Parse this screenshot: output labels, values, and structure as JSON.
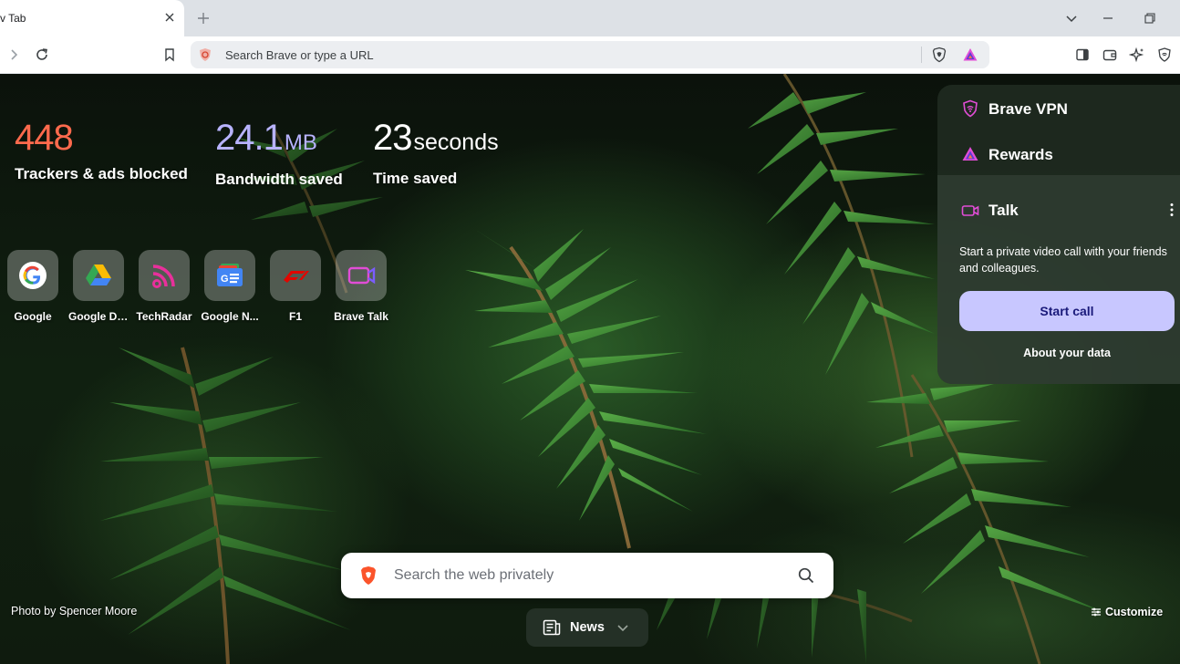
{
  "tab": {
    "title": "v Tab"
  },
  "toolbar": {
    "url_placeholder": "Search Brave or type a URL"
  },
  "stats": [
    {
      "value": "448",
      "unit": "",
      "label": "Trackers & ads blocked",
      "color": "#ff6a4d"
    },
    {
      "value": "24.1",
      "unit": "MB",
      "label": "Bandwidth saved",
      "color": "#b8b3ff"
    },
    {
      "value": "23",
      "unit": "seconds",
      "label": "Time saved",
      "color": "#ffffff"
    }
  ],
  "top_sites": [
    {
      "label": "Google",
      "icon": "google-icon"
    },
    {
      "label": "Google Dr...",
      "icon": "google-drive-icon"
    },
    {
      "label": "TechRadar",
      "icon": "techradar-icon"
    },
    {
      "label": "Google N...",
      "icon": "google-news-icon"
    },
    {
      "label": "F1",
      "icon": "f1-icon"
    },
    {
      "label": "Brave Talk",
      "icon": "brave-talk-icon"
    }
  ],
  "widgets": {
    "vpn": "Brave VPN",
    "rewards": "Rewards",
    "talk": {
      "title": "Talk",
      "description": "Start a private video call with your friends and colleagues.",
      "button": "Start call",
      "about": "About your data"
    }
  },
  "search": {
    "placeholder": "Search the web privately"
  },
  "photo_credit": "Photo by Spencer Moore",
  "news": {
    "label": "News"
  },
  "customize": {
    "label": "Customize"
  },
  "colors": {
    "accent": "#c8c7ff",
    "brave_orange": "#fb542b",
    "talk_purple": "#e14dd6"
  }
}
